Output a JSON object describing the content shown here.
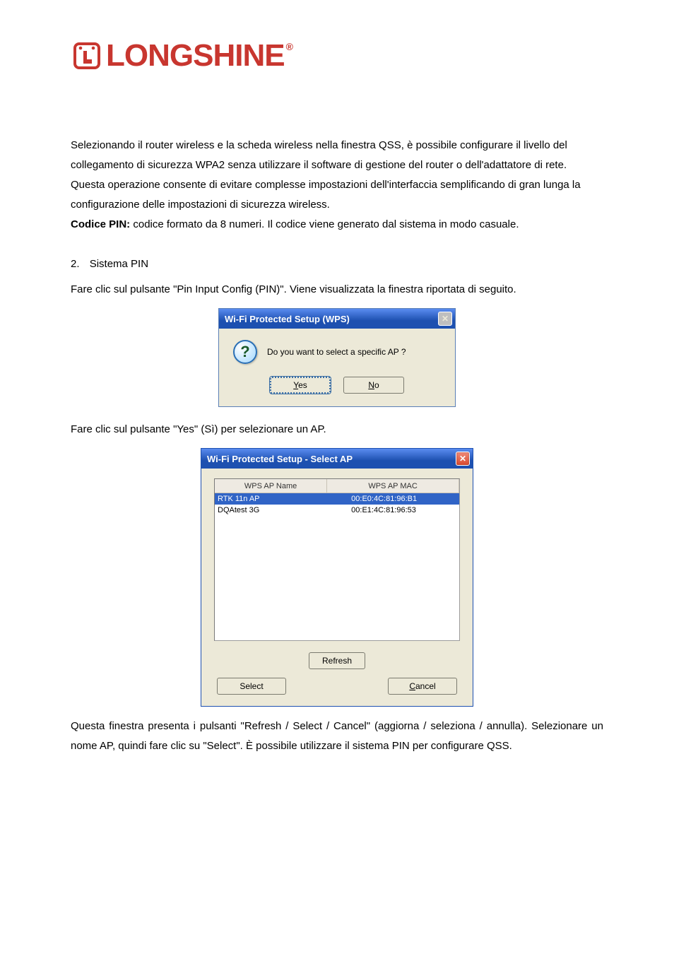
{
  "logo": {
    "text": "LONGSHINE",
    "reg": "®"
  },
  "p1": "Selezionando il router wireless e la scheda wireless nella finestra QSS, è possibile configurare il livello del collegamento di sicurezza WPA2 senza utilizzare il software di gestione del router o dell'adattatore di rete. Questa operazione consente di evitare complesse impostazioni dell'interfaccia semplificando di gran lunga la configurazione delle impostazioni di sicurezza wireless.",
  "p2_bold": "Codice PIN:",
  "p2_rest": " codice formato da 8 numeri. Il codice viene generato dal sistema in modo casuale.",
  "list1": "Sistema PIN",
  "p3": "Fare clic sul pulsante \"Pin Input Config (PIN)\". Viene visualizzata la finestra riportata di seguito.",
  "dialog1": {
    "title": "Wi-Fi Protected Setup (WPS)",
    "msg": "Do you want to select a specific AP ?",
    "yes_pre": "Y",
    "yes_rest": "es",
    "no_pre": "N",
    "no_rest": "o"
  },
  "p4": "Fare clic sul pulsante \"Yes\" (Sì) per selezionare un AP.",
  "dialog2": {
    "title": "Wi-Fi Protected Setup - Select AP",
    "col1": "WPS AP Name",
    "col2": "WPS AP MAC",
    "rows": [
      {
        "name": "RTK 11n AP",
        "mac": "00:E0:4C:81:96:B1",
        "selected": true
      },
      {
        "name": "DQAtest  3G",
        "mac": "00:E1:4C:81:96:53",
        "selected": false
      }
    ],
    "refresh": "Refresh",
    "select": "Select",
    "cancel_pre": "C",
    "cancel_rest": "ancel"
  },
  "p5": "Questa finestra presenta i pulsanti \"Refresh / Select / Cancel\" (aggiorna / seleziona / annulla). Selezionare un nome AP, quindi fare clic su \"Select\". È possibile utilizzare il sistema PIN per configurare QSS."
}
